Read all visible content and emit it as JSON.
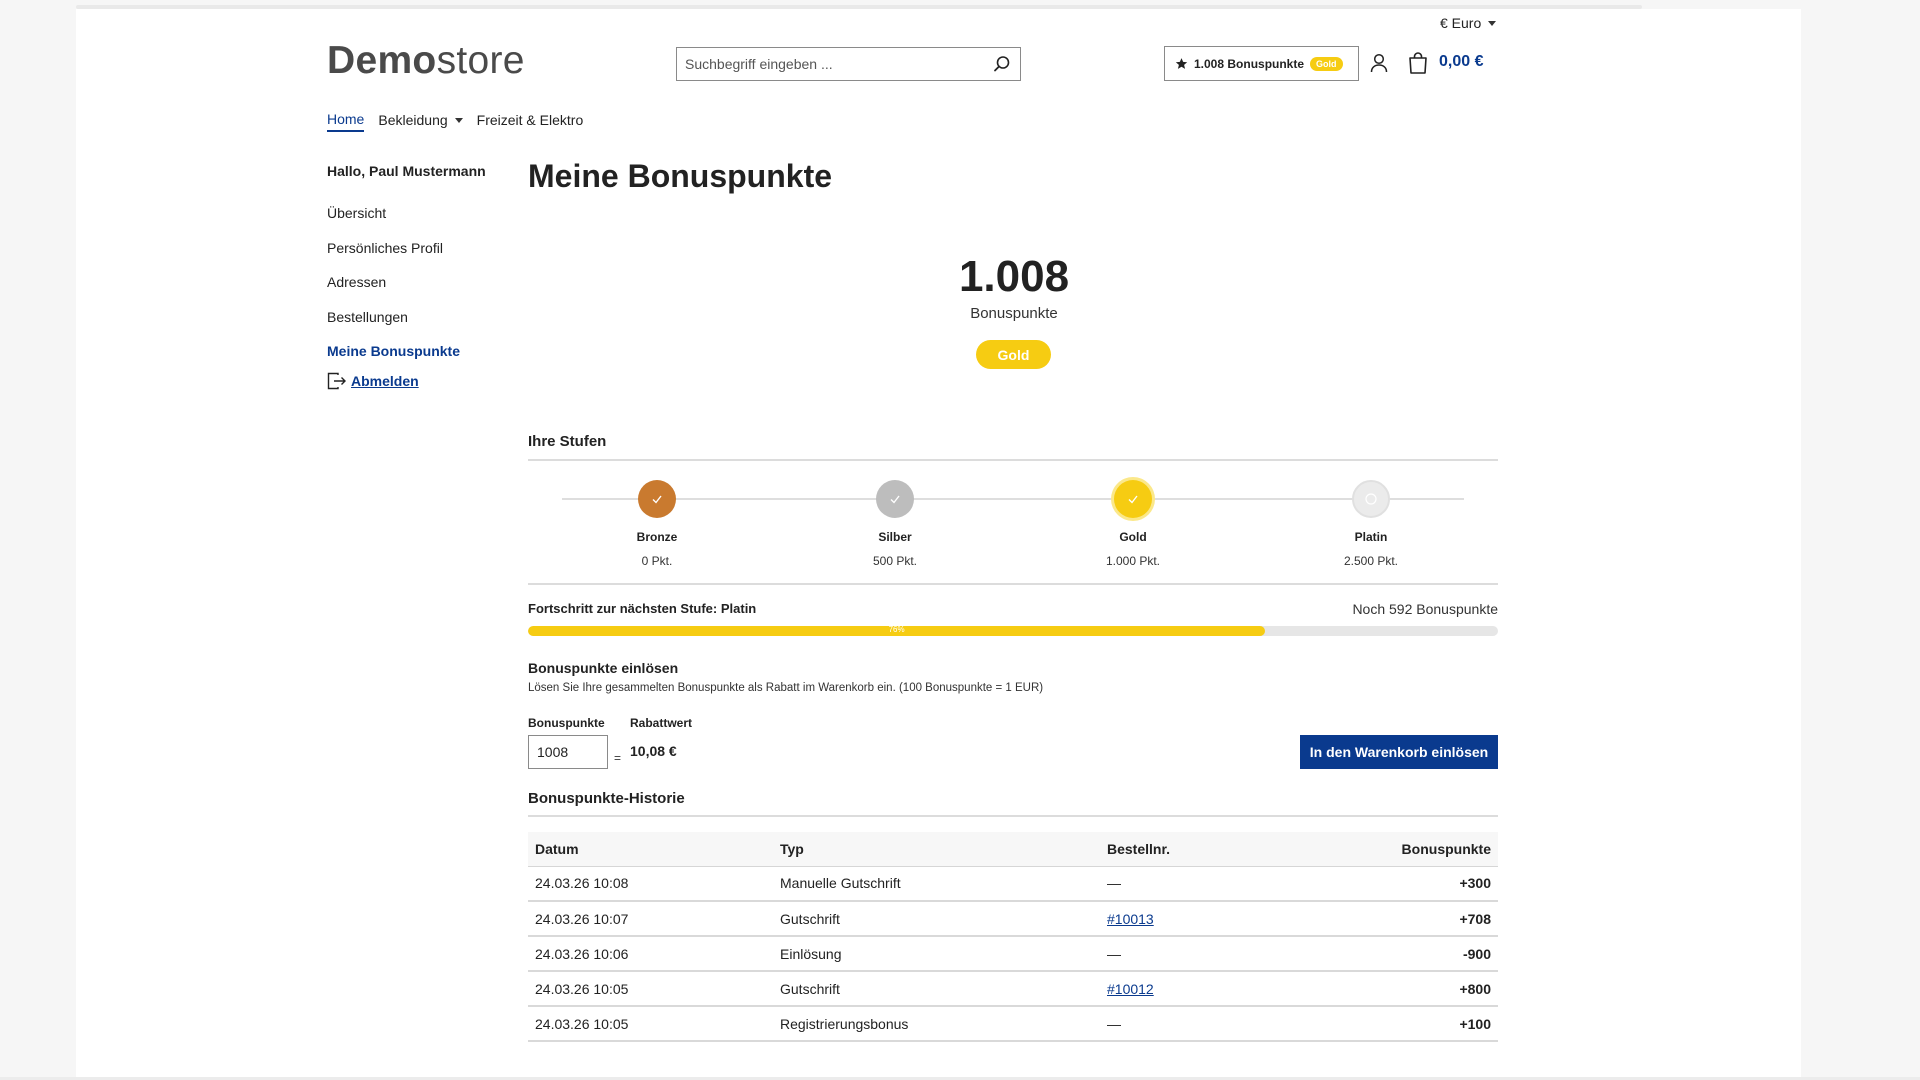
{
  "header": {
    "currency": "€ Euro",
    "logo_bold": "Demo",
    "logo_light": "store",
    "search_placeholder": "Suchbegriff eingeben ...",
    "bonus_button_label": "1.008 Bonuspunkte",
    "bonus_button_badge": "Gold",
    "cart_total": "0,00 €"
  },
  "nav": {
    "items": [
      "Home",
      "Bekleidung",
      "Freizeit & Elektro"
    ],
    "active": "Home"
  },
  "sidebar": {
    "greeting": "Hallo, Paul Mustermann",
    "items": [
      "Übersicht",
      "Persönliches Profil",
      "Adressen",
      "Bestellungen",
      "Meine Bonuspunkte"
    ],
    "active": "Meine Bonuspunkte",
    "logout": "Abmelden"
  },
  "main": {
    "title": "Meine Bonuspunkte",
    "points_value": "1.008",
    "points_label": "Bonuspunkte",
    "current_tier": "Gold",
    "tiers_heading": "Ihre Stufen",
    "tiers": [
      {
        "name": "Bronze",
        "points": "0 Pkt.",
        "color": "#c97a2f",
        "reached": true
      },
      {
        "name": "Silber",
        "points": "500 Pkt.",
        "color": "#bdbdbd",
        "reached": true
      },
      {
        "name": "Gold",
        "points": "1.000 Pkt.",
        "color": "#f6cc12",
        "reached": true
      },
      {
        "name": "Platin",
        "points": "2.500 Pkt.",
        "color": "#ebebeb",
        "reached": false
      }
    ],
    "progress": {
      "label": "Fortschritt zur nächsten Stufe: Platin",
      "remaining": "Noch 592 Bonuspunkte",
      "percent_label": "76%",
      "fraction": 0.76
    },
    "redeem": {
      "heading": "Bonuspunkte einlösen",
      "description": "Lösen Sie Ihre gesammelten Bonuspunkte als Rabatt im Warenkorb ein. (100 Bonuspunkte = 1 EUR)",
      "points_label": "Bonuspunkte",
      "discount_label": "Rabattwert",
      "points_value": "1008",
      "equals": "=",
      "discount_value": "10,08 €",
      "button_label": "In den Warenkorb einlösen"
    },
    "history": {
      "heading": "Bonuspunkte-Historie",
      "columns": [
        "Datum",
        "Typ",
        "Bestellnr.",
        "Bonuspunkte"
      ],
      "rows": [
        {
          "date": "24.03.26 10:08",
          "type": "Manuelle Gutschrift",
          "order": "—",
          "order_link": false,
          "points": "+300"
        },
        {
          "date": "24.03.26 10:07",
          "type": "Gutschrift",
          "order": "#10013",
          "order_link": true,
          "points": "+708"
        },
        {
          "date": "24.03.26 10:06",
          "type": "Einlösung",
          "order": "—",
          "order_link": false,
          "points": "-900"
        },
        {
          "date": "24.03.26 10:05",
          "type": "Gutschrift",
          "order": "#10012",
          "order_link": true,
          "points": "+800"
        },
        {
          "date": "24.03.26 10:05",
          "type": "Registrierungsbonus",
          "order": "—",
          "order_link": false,
          "points": "+100"
        }
      ]
    }
  },
  "colors": {
    "primary": "#0a3a8e",
    "gold": "#f6cc12"
  }
}
